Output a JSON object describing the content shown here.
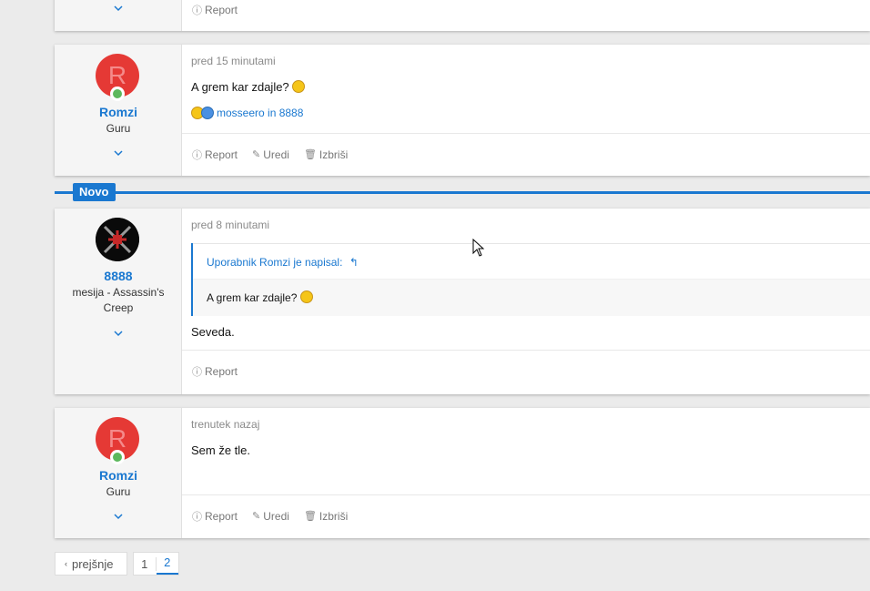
{
  "top_post": {
    "report_label": "Report",
    "chevron": "⌄"
  },
  "posts": [
    {
      "avatar_letter": "R",
      "username": "Romzi",
      "user_title": "Guru",
      "time": "pred 15 minutami",
      "message": "A grem kar zdajle?",
      "reactions_text": "mosseero in 8888",
      "actions": {
        "report": "Report",
        "edit": "Uredi",
        "delete": "Izbriši"
      }
    },
    {
      "username": "8888",
      "user_title_line1": "mesija - Assassin's",
      "user_title_line2": "Creep",
      "time": "pred 8 minutami",
      "quote_header": "Uporabnik Romzi je napisal:",
      "quote_text": "A grem kar zdajle?",
      "message": "Seveda.",
      "actions": {
        "report": "Report"
      }
    },
    {
      "avatar_letter": "R",
      "username": "Romzi",
      "user_title": "Guru",
      "time": "trenutek nazaj",
      "message": "Sem že tle.",
      "actions": {
        "report": "Report",
        "edit": "Uredi",
        "delete": "Izbriši"
      }
    }
  ],
  "divider_label": "Novo",
  "pagination": {
    "prev_label": "prejšnje",
    "pages": [
      "1",
      "2"
    ],
    "current": "2"
  },
  "icons": {
    "report": "info-circle-icon",
    "edit": "pencil-icon",
    "delete": "trash-icon",
    "chevron": "chevron-down-icon"
  },
  "colors": {
    "accent": "#1a78d0",
    "avatar_red": "#e53935",
    "online_green": "#5cb85c"
  }
}
